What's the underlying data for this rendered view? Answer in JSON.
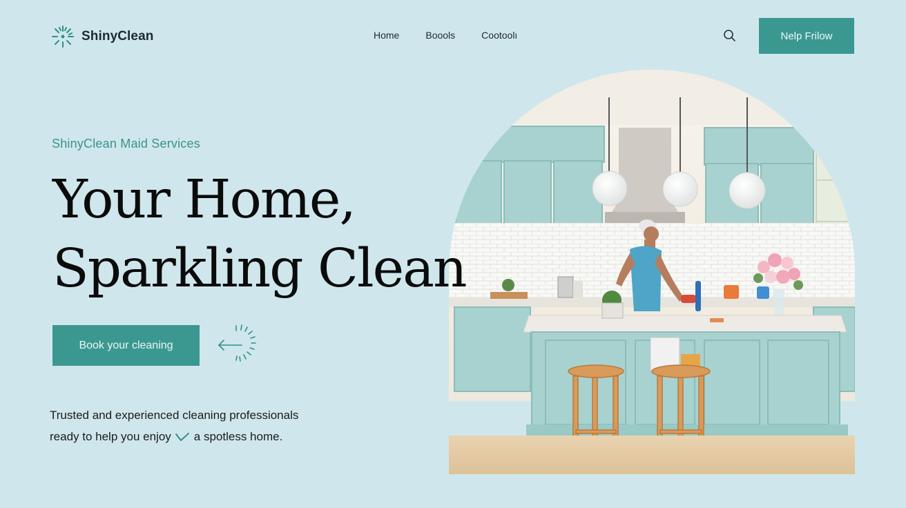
{
  "header": {
    "brand": "ShinyClean",
    "logo_icon": "sparkle-icon",
    "nav": [
      {
        "label": "Home"
      },
      {
        "label": "Boools"
      },
      {
        "label": "Cootoolı"
      }
    ],
    "search_icon": "search-icon",
    "cta_label": "Nelp Frilow"
  },
  "hero": {
    "eyebrow": "ShinyClean Maid Services",
    "headline_line1": "Your Home,",
    "headline_line2": "Sparkling Clean",
    "book_button": "Book your cleaning",
    "decor_icon": "sparkle-arrow-icon",
    "description_line1": "Trusted and experienced cleaning professionals",
    "description_line2a": "ready to help you enjoy",
    "description_line2b": "a spotless home.",
    "check_icon": "checkmark-icon",
    "image_subject": "kitchen-cleaning-photo"
  },
  "colors": {
    "background": "#cfe7ec",
    "accent": "#3b9891",
    "eyebrow": "#3a928c",
    "text": "#0b0b0b"
  }
}
